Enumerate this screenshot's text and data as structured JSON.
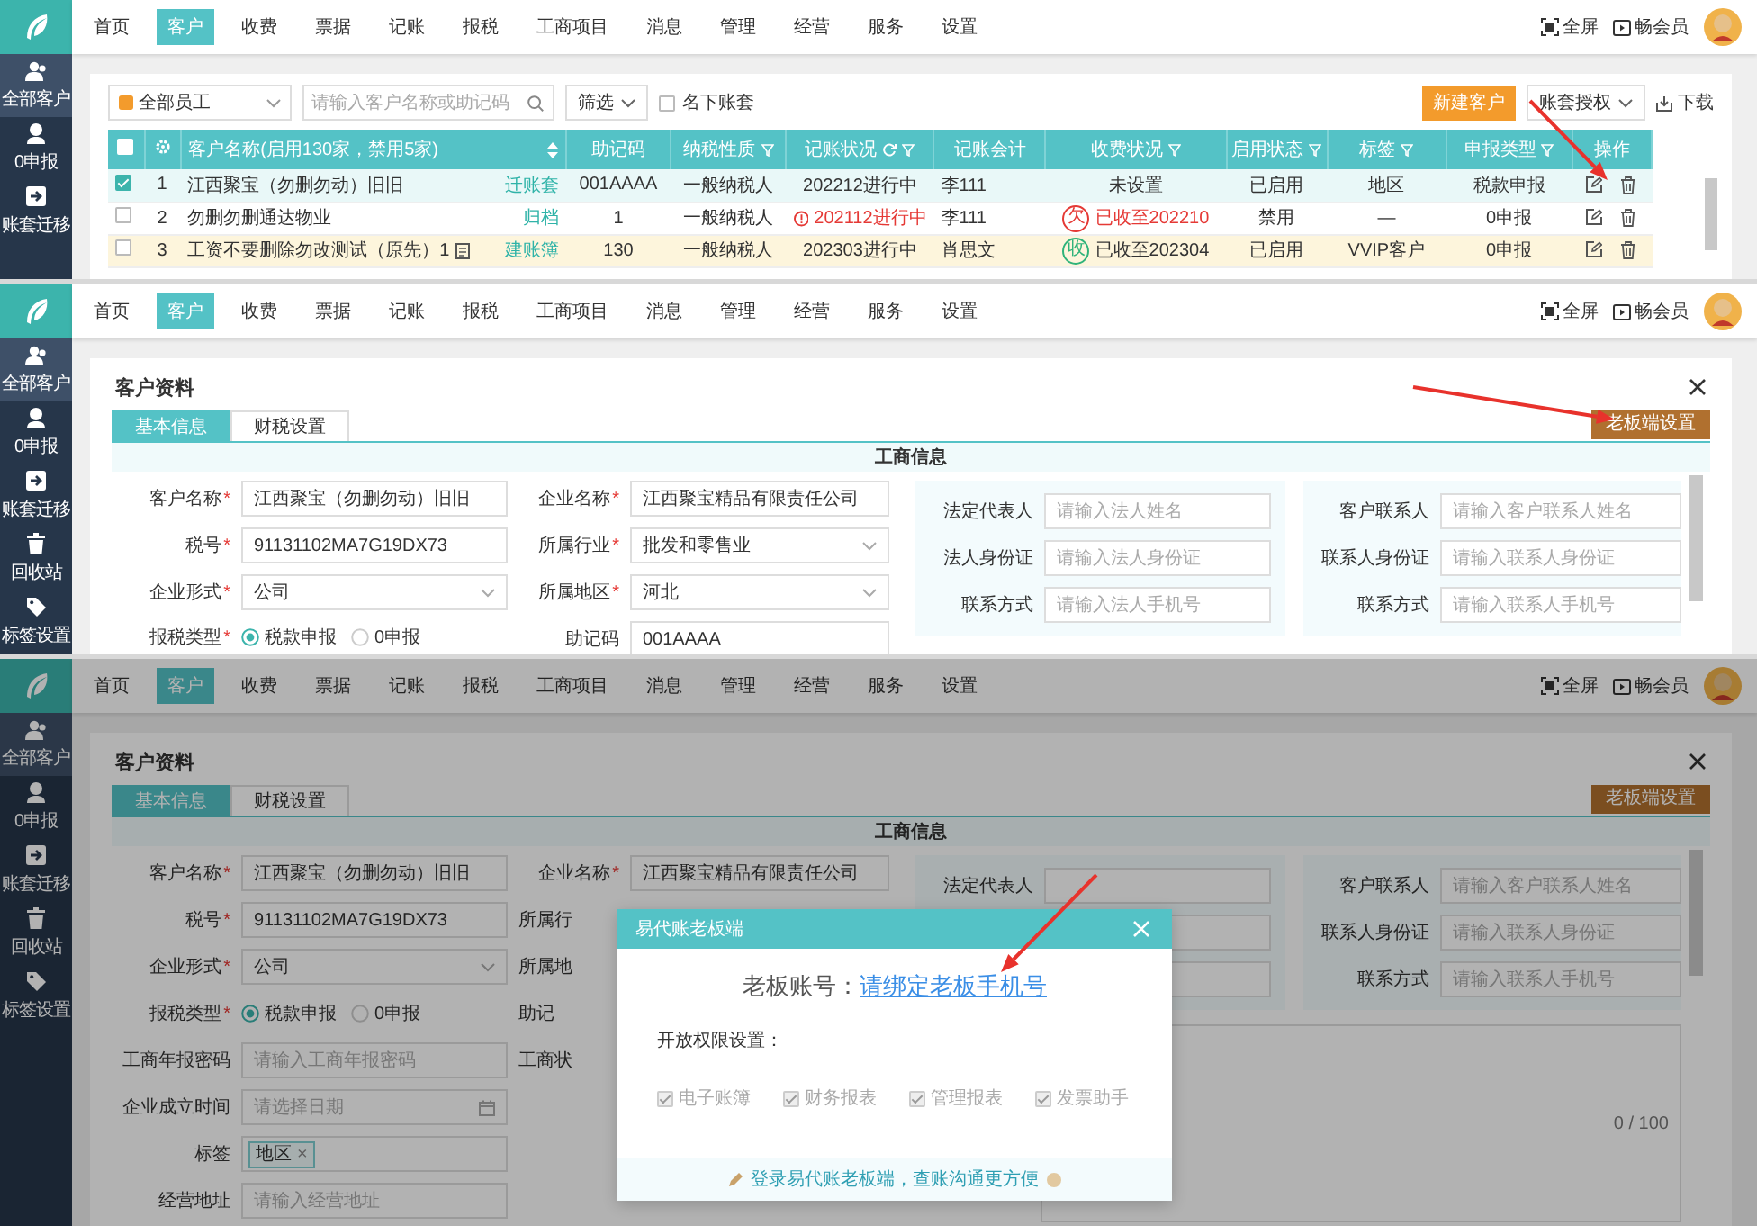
{
  "panels": [
    {
      "kind": "customer_list",
      "nav": {
        "items": [
          {
            "label": "首页",
            "selected": false
          },
          {
            "label": "客户",
            "selected": true
          },
          {
            "label": "收费",
            "selected": false
          },
          {
            "label": "票据",
            "selected": false
          },
          {
            "label": "记账",
            "selected": false
          },
          {
            "label": "报税",
            "selected": false
          },
          {
            "label": "工商项目",
            "selected": false
          },
          {
            "label": "消息",
            "selected": false
          },
          {
            "label": "管理",
            "selected": false
          },
          {
            "label": "经营",
            "selected": false
          },
          {
            "label": "服务",
            "selected": false
          },
          {
            "label": "设置",
            "selected": false
          }
        ],
        "fullscreen": "全屏",
        "member": "畅会员"
      },
      "sidebar": [
        {
          "label": "全部客户",
          "selected": true
        },
        {
          "label": "0申报",
          "selected": false
        },
        {
          "label": "账套迁移",
          "selected": false
        }
      ],
      "toolbar": {
        "staff": "全部员工",
        "search_placeholder": "请输入客户名称或助记码",
        "filter": "筛选",
        "own_only": {
          "label": "名下账套",
          "checked": false
        },
        "new_button": "新建客户",
        "authorize": "账套授权",
        "download": "下载"
      },
      "table": {
        "select_all": false,
        "columns": [
          {
            "label": "客户名称(启用130家，禁用5家)",
            "kind": "sort"
          },
          {
            "label": "助记码",
            "kind": "plain"
          },
          {
            "label": "纳税性质",
            "kind": "filter"
          },
          {
            "label": "记账状况",
            "kind": "refresh"
          },
          {
            "label": "记账会计",
            "kind": "plain"
          },
          {
            "label": "收费状况",
            "kind": "filter"
          },
          {
            "label": "启用状态",
            "kind": "filter"
          },
          {
            "label": "标签",
            "kind": "filter"
          },
          {
            "label": "申报类型",
            "kind": "filter"
          },
          {
            "label": "操作",
            "kind": "plain"
          }
        ],
        "rows": [
          {
            "selected": true,
            "hovered": false,
            "index": "1",
            "name": "江西聚宝（勿删勿动）旧旧",
            "name_link": "迁账套",
            "note_icon": false,
            "code": "001AAAA",
            "tax_type": "一般纳税人",
            "booking": {
              "text": "202212进行中",
              "overdue": false
            },
            "accountant": "李111",
            "fee": {
              "text": "未设置",
              "kind": "none"
            },
            "enabled": "已启用",
            "tag": "地区",
            "declare": "税款申报"
          },
          {
            "selected": false,
            "hovered": false,
            "index": "2",
            "name": "勿删勿删通达物业",
            "name_link": "归档",
            "note_icon": false,
            "code": "1",
            "tax_type": "一般纳税人",
            "booking": {
              "text": "202112进行中",
              "overdue": true
            },
            "accountant": "李111",
            "fee": {
              "text": "已收至202210",
              "kind": "owed",
              "badge": "欠"
            },
            "enabled": "禁用",
            "tag": "—",
            "declare": "0申报"
          },
          {
            "selected": false,
            "hovered": true,
            "index": "3",
            "name": "工资不要删除勿改测试（原先）1",
            "name_link": "建账簿",
            "note_icon": true,
            "code": "130",
            "tax_type": "一般纳税人",
            "booking": {
              "text": "202303进行中",
              "overdue": false
            },
            "accountant": "肖思文",
            "fee": {
              "text": "已收至202304",
              "kind": "paid",
              "badge": "收"
            },
            "enabled": "已启用",
            "tag": "VVIP客户",
            "declare": "0申报"
          }
        ]
      }
    },
    {
      "kind": "customer_form",
      "nav": {
        "items": [
          {
            "label": "首页",
            "selected": false
          },
          {
            "label": "客户",
            "selected": true
          },
          {
            "label": "收费",
            "selected": false
          },
          {
            "label": "票据",
            "selected": false
          },
          {
            "label": "记账",
            "selected": false
          },
          {
            "label": "报税",
            "selected": false
          },
          {
            "label": "工商项目",
            "selected": false
          },
          {
            "label": "消息",
            "selected": false
          },
          {
            "label": "管理",
            "selected": false
          },
          {
            "label": "经营",
            "selected": false
          },
          {
            "label": "服务",
            "selected": false
          },
          {
            "label": "设置",
            "selected": false
          }
        ],
        "fullscreen": "全屏",
        "member": "畅会员"
      },
      "sidebar": [
        {
          "label": "全部客户",
          "selected": true
        },
        {
          "label": "0申报",
          "selected": false
        },
        {
          "label": "账套迁移",
          "selected": false
        },
        {
          "label": "回收站",
          "selected": false
        },
        {
          "label": "标签设置",
          "selected": false
        }
      ],
      "title": "客户资料",
      "tabs": [
        {
          "label": "基本信息",
          "selected": true
        },
        {
          "label": "财税设置",
          "selected": false
        }
      ],
      "boss_button": "老板端设置",
      "section": "工商信息",
      "columns": [
        [
          {
            "kind": "text",
            "label": "客户名称",
            "mark": "*",
            "value": "江西聚宝（勿删勿动）旧旧"
          },
          {
            "kind": "text",
            "label": "税号",
            "mark": "*",
            "value": "91131102MA7G19DX73"
          },
          {
            "kind": "select",
            "label": "企业形式",
            "mark": "*",
            "value": "公司"
          },
          {
            "kind": "radio",
            "label": "报税类型",
            "mark": "*",
            "options": [
              {
                "label": "税款申报",
                "selected": true
              },
              {
                "label": "0申报",
                "selected": false
              }
            ]
          }
        ],
        [
          {
            "kind": "text",
            "label": "企业名称",
            "mark": "*",
            "value": "江西聚宝精品有限责任公司"
          },
          {
            "kind": "select",
            "label": "所属行业",
            "mark": "*",
            "value": "批发和零售业"
          },
          {
            "kind": "select",
            "label": "所属地区",
            "mark": "*",
            "value": "河北"
          },
          {
            "kind": "text",
            "label": "助记码",
            "value": "001AAAA"
          }
        ]
      ],
      "contact_panels": [
        [
          {
            "kind": "text",
            "label": "法定代表人",
            "placeholder": "请输入法人姓名"
          },
          {
            "kind": "text",
            "label": "法人身份证",
            "placeholder": "请输入法人身份证"
          },
          {
            "kind": "text",
            "label": "联系方式",
            "placeholder": "请输入法人手机号"
          }
        ],
        [
          {
            "kind": "text",
            "label": "客户联系人",
            "placeholder": "请输入客户联系人姓名"
          },
          {
            "kind": "text",
            "label": "联系人身份证",
            "placeholder": "请输入联系人身份证"
          },
          {
            "kind": "text",
            "label": "联系方式",
            "placeholder": "请输入联系人手机号"
          }
        ]
      ]
    },
    {
      "kind": "customer_form",
      "nav": {
        "items": [
          {
            "label": "首页",
            "selected": false
          },
          {
            "label": "客户",
            "selected": true
          },
          {
            "label": "收费",
            "selected": false
          },
          {
            "label": "票据",
            "selected": false
          },
          {
            "label": "记账",
            "selected": false
          },
          {
            "label": "报税",
            "selected": false
          },
          {
            "label": "工商项目",
            "selected": false
          },
          {
            "label": "消息",
            "selected": false
          },
          {
            "label": "管理",
            "selected": false
          },
          {
            "label": "经营",
            "selected": false
          },
          {
            "label": "服务",
            "selected": false
          },
          {
            "label": "设置",
            "selected": false
          }
        ],
        "fullscreen": "全屏",
        "member": "畅会员"
      },
      "sidebar": [
        {
          "label": "全部客户",
          "selected": true
        },
        {
          "label": "0申报",
          "selected": false
        },
        {
          "label": "账套迁移",
          "selected": false
        },
        {
          "label": "回收站",
          "selected": false
        },
        {
          "label": "标签设置",
          "selected": false
        }
      ],
      "title": "客户资料",
      "tabs": [
        {
          "label": "基本信息",
          "selected": true
        },
        {
          "label": "财税设置",
          "selected": false
        }
      ],
      "boss_button": "老板端设置",
      "section": "工商信息",
      "columns": [
        [
          {
            "kind": "text",
            "label": "客户名称",
            "mark": "*",
            "value": "江西聚宝（勿删勿动）旧旧"
          },
          {
            "kind": "text",
            "label": "税号",
            "mark": "*",
            "value": "91131102MA7G19DX73"
          },
          {
            "kind": "select",
            "label": "企业形式",
            "mark": "*",
            "value": "公司"
          },
          {
            "kind": "radio",
            "label": "报税类型",
            "mark": "*",
            "options": [
              {
                "label": "税款申报",
                "selected": true
              },
              {
                "label": "0申报",
                "selected": false
              }
            ]
          },
          {
            "kind": "text",
            "label": "工商年报密码",
            "placeholder": "请输入工商年报密码"
          },
          {
            "kind": "date",
            "label": "企业成立时间",
            "placeholder": "请选择日期"
          },
          {
            "kind": "tags",
            "label": "标签",
            "tags": [
              {
                "label": "地区",
                "close": "×"
              }
            ]
          },
          {
            "kind": "text",
            "label": "经营地址",
            "placeholder": "请输入经营地址"
          }
        ],
        [
          {
            "kind": "text",
            "label": "企业名称",
            "mark": "*",
            "value": "江西聚宝精品有限责任公司"
          },
          {
            "kind": "label",
            "label": "所属行"
          },
          {
            "kind": "label",
            "label": "所属地"
          },
          {
            "kind": "label",
            "label": "助记"
          },
          {
            "kind": "label",
            "label": "工商状"
          }
        ]
      ],
      "contact_panels": [
        [
          {
            "kind": "text",
            "label": "法定代表人"
          },
          {
            "kind": "blank"
          },
          {
            "kind": "blank"
          }
        ],
        [
          {
            "kind": "text",
            "label": "客户联系人",
            "placeholder": "请输入客户联系人姓名"
          },
          {
            "kind": "text",
            "label": "联系人身份证",
            "placeholder": "请输入联系人身份证"
          },
          {
            "kind": "text",
            "label": "联系方式",
            "placeholder": "请输入联系人手机号"
          }
        ]
      ],
      "note": {
        "counter": "0 / 100"
      },
      "overlay": true,
      "dialog": {
        "title": "易代账老板端",
        "account_label": "老板账号：",
        "account_link": "请绑定老板手机号",
        "permissions_title": "开放权限设置：",
        "permissions": [
          {
            "label": "电子账簿",
            "checked": true,
            "disabled": true
          },
          {
            "label": "财务报表",
            "checked": true,
            "disabled": true
          },
          {
            "label": "管理报表",
            "checked": true,
            "disabled": true
          },
          {
            "label": "发票助手",
            "checked": true,
            "disabled": true
          }
        ],
        "footer": "登录易代账老板端，查账沟通更方便"
      }
    }
  ]
}
